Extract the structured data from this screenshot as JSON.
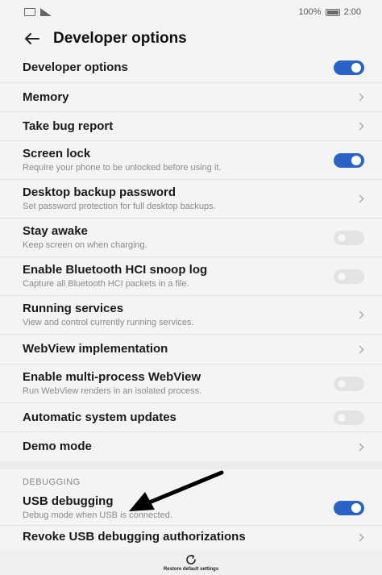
{
  "status_bar": {
    "battery": "100%",
    "time": "2:00"
  },
  "app_bar": {
    "title": "Developer options"
  },
  "rows": [
    {
      "title": "Developer options",
      "subtitle": "",
      "control": "toggle",
      "state": "on"
    },
    {
      "title": "Memory",
      "subtitle": "",
      "control": "chevron"
    },
    {
      "title": "Take bug report",
      "subtitle": "",
      "control": "chevron"
    },
    {
      "title": "Screen lock",
      "subtitle": "Require your phone to be unlocked before using it.",
      "control": "toggle",
      "state": "on"
    },
    {
      "title": "Desktop backup password",
      "subtitle": "Set password protection for full desktop backups.",
      "control": "chevron"
    },
    {
      "title": "Stay awake",
      "subtitle": "Keep screen on when charging.",
      "control": "toggle",
      "state": "off"
    },
    {
      "title": "Enable Bluetooth HCI snoop log",
      "subtitle": "Capture all Bluetooth HCI packets in a file.",
      "control": "toggle",
      "state": "off"
    },
    {
      "title": "Running services",
      "subtitle": "View and control currently running services.",
      "control": "chevron"
    },
    {
      "title": "WebView implementation",
      "subtitle": "",
      "control": "chevron"
    },
    {
      "title": "Enable multi-process WebView",
      "subtitle": "Run WebView renders in an isolated process.",
      "control": "toggle",
      "state": "off"
    },
    {
      "title": "Automatic system updates",
      "subtitle": "",
      "control": "toggle",
      "state": "off"
    },
    {
      "title": "Demo mode",
      "subtitle": "",
      "control": "chevron"
    }
  ],
  "debugging": {
    "header": "DEBUGGING",
    "rows": [
      {
        "title": "USB debugging",
        "subtitle": "Debug mode when USB is connected.",
        "control": "toggle",
        "state": "on"
      },
      {
        "title": "Revoke USB debugging authorizations",
        "subtitle": "",
        "control": "chevron"
      }
    ]
  },
  "bottom_bar": {
    "label": "Restore default settings"
  },
  "colors": {
    "accent": "#2a63c8",
    "background": "#f4f4f4",
    "toggle_off": "#e3e3e3"
  },
  "icons": {
    "back": "arrow-left-icon",
    "chevron": "chevron-right-icon",
    "restore": "restore-icon",
    "annotation": "arrow-annotation"
  }
}
